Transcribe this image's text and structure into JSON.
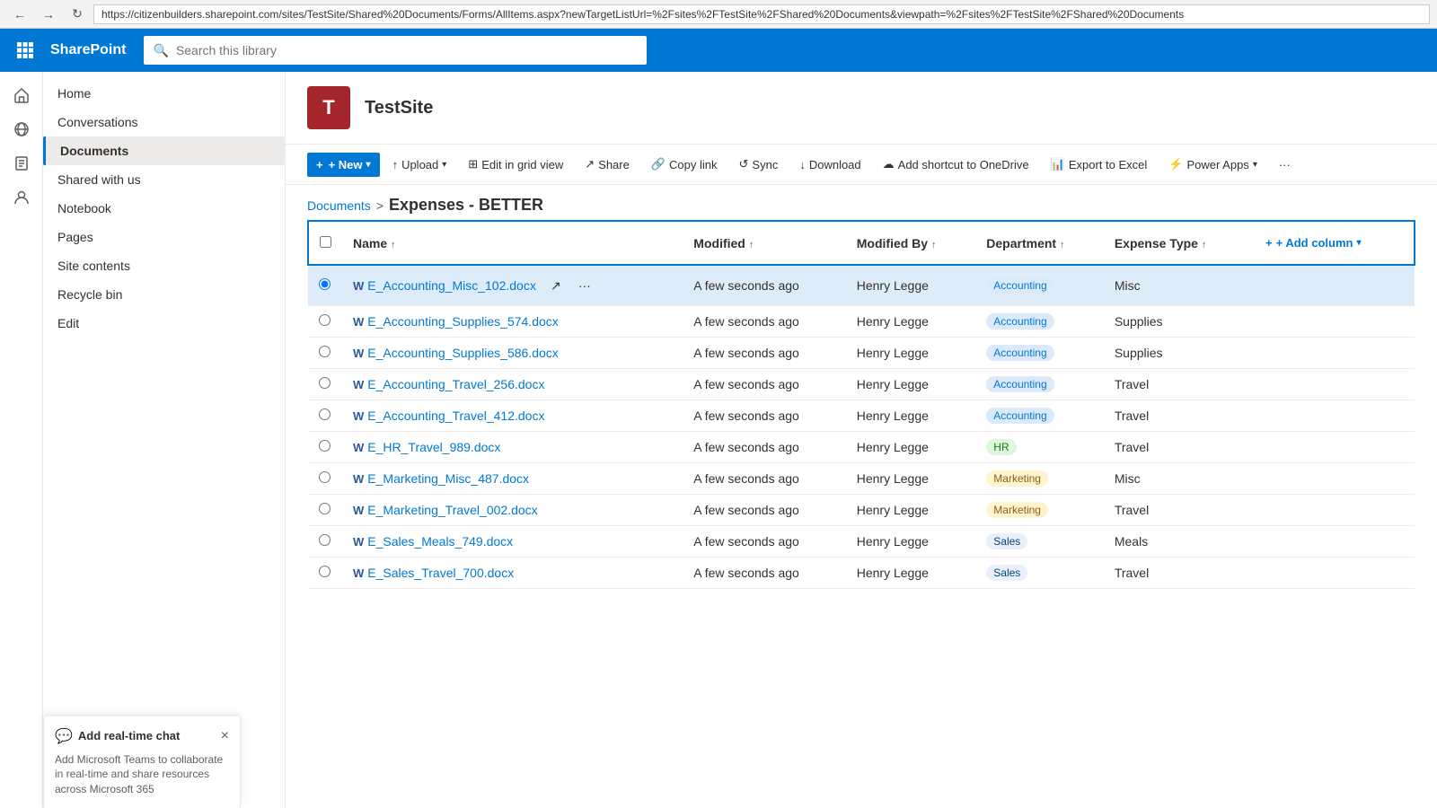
{
  "browser": {
    "url": "https://citizenbuilders.sharepoint.com/sites/TestSite/Shared%20Documents/Forms/AllItems.aspx?newTargetListUrl=%2Fsites%2FTestSite%2FShared%20Documents&viewpath=%2Fsites%2FTestSite%2FShared%20Documents",
    "back_label": "←",
    "forward_label": "→",
    "refresh_label": "↻"
  },
  "topbar": {
    "app_name": "SharePoint",
    "search_placeholder": "Search this library"
  },
  "site": {
    "logo_letter": "T",
    "title": "TestSite"
  },
  "toolbar": {
    "new_label": "+ New",
    "upload_label": "Upload",
    "edit_grid_label": "Edit in grid view",
    "share_label": "Share",
    "copy_link_label": "Copy link",
    "sync_label": "Sync",
    "download_label": "Download",
    "add_shortcut_label": "Add shortcut to OneDrive",
    "export_excel_label": "Export to Excel",
    "power_apps_label": "Power Apps",
    "more_label": "..."
  },
  "breadcrumb": {
    "documents_label": "Documents",
    "separator": ">",
    "current": "Expenses - BETTER"
  },
  "table": {
    "columns": [
      {
        "key": "name",
        "label": "Name",
        "sortable": true
      },
      {
        "key": "modified",
        "label": "Modified",
        "sortable": true
      },
      {
        "key": "modified_by",
        "label": "Modified By",
        "sortable": true
      },
      {
        "key": "department",
        "label": "Department",
        "sortable": true
      },
      {
        "key": "expense_type",
        "label": "Expense Type",
        "sortable": true
      }
    ],
    "add_column_label": "+ Add column",
    "rows": [
      {
        "name": "E_Accounting_Misc_102.docx",
        "modified": "A few seconds ago",
        "modified_by": "Henry Legge",
        "department": "Accounting",
        "dept_class": "badge-accounting",
        "expense_type": "Misc",
        "selected": true
      },
      {
        "name": "E_Accounting_Supplies_574.docx",
        "modified": "A few seconds ago",
        "modified_by": "Henry Legge",
        "department": "Accounting",
        "dept_class": "badge-accounting",
        "expense_type": "Supplies",
        "selected": false
      },
      {
        "name": "E_Accounting_Supplies_586.docx",
        "modified": "A few seconds ago",
        "modified_by": "Henry Legge",
        "department": "Accounting",
        "dept_class": "badge-accounting",
        "expense_type": "Supplies",
        "selected": false
      },
      {
        "name": "E_Accounting_Travel_256.docx",
        "modified": "A few seconds ago",
        "modified_by": "Henry Legge",
        "department": "Accounting",
        "dept_class": "badge-accounting",
        "expense_type": "Travel",
        "selected": false
      },
      {
        "name": "E_Accounting_Travel_412.docx",
        "modified": "A few seconds ago",
        "modified_by": "Henry Legge",
        "department": "Accounting",
        "dept_class": "badge-accounting",
        "expense_type": "Travel",
        "selected": false
      },
      {
        "name": "E_HR_Travel_989.docx",
        "modified": "A few seconds ago",
        "modified_by": "Henry Legge",
        "department": "HR",
        "dept_class": "badge-hr",
        "expense_type": "Travel",
        "selected": false
      },
      {
        "name": "E_Marketing_Misc_487.docx",
        "modified": "A few seconds ago",
        "modified_by": "Henry Legge",
        "department": "Marketing",
        "dept_class": "badge-marketing",
        "expense_type": "Misc",
        "selected": false
      },
      {
        "name": "E_Marketing_Travel_002.docx",
        "modified": "A few seconds ago",
        "modified_by": "Henry Legge",
        "department": "Marketing",
        "dept_class": "badge-marketing",
        "expense_type": "Travel",
        "selected": false
      },
      {
        "name": "E_Sales_Meals_749.docx",
        "modified": "A few seconds ago",
        "modified_by": "Henry Legge",
        "department": "Sales",
        "dept_class": "badge-sales",
        "expense_type": "Meals",
        "selected": false
      },
      {
        "name": "E_Sales_Travel_700.docx",
        "modified": "A few seconds ago",
        "modified_by": "Henry Legge",
        "department": "Sales",
        "dept_class": "badge-sales",
        "expense_type": "Travel",
        "selected": false
      }
    ]
  },
  "left_nav": {
    "items": [
      {
        "label": "Home",
        "active": false
      },
      {
        "label": "Conversations",
        "active": false
      },
      {
        "label": "Documents",
        "active": true
      },
      {
        "label": "Shared with us",
        "active": false
      },
      {
        "label": "Notebook",
        "active": false
      },
      {
        "label": "Pages",
        "active": false
      },
      {
        "label": "Site contents",
        "active": false
      },
      {
        "label": "Recycle bin",
        "active": false
      },
      {
        "label": "Edit",
        "active": false
      }
    ]
  },
  "chat_widget": {
    "title": "Add real-time chat",
    "description": "Add Microsoft Teams to collaborate in real-time and share resources across Microsoft 365",
    "close_label": "×"
  },
  "icons": {
    "waffle": "⊞",
    "home": "⌂",
    "global": "🌐",
    "notes": "📋",
    "people": "👤",
    "search_mag": "🔍",
    "upload_arrow": "↑",
    "share": "↗",
    "link": "🔗",
    "sync": "↺",
    "download": "↓",
    "onedrive": "☁",
    "excel": "📊",
    "power": "⚡",
    "chevron_down": "▾",
    "sort_asc": "↑",
    "add": "+",
    "word_icon": "W",
    "share_row": "↗",
    "ellipsis": "···"
  }
}
